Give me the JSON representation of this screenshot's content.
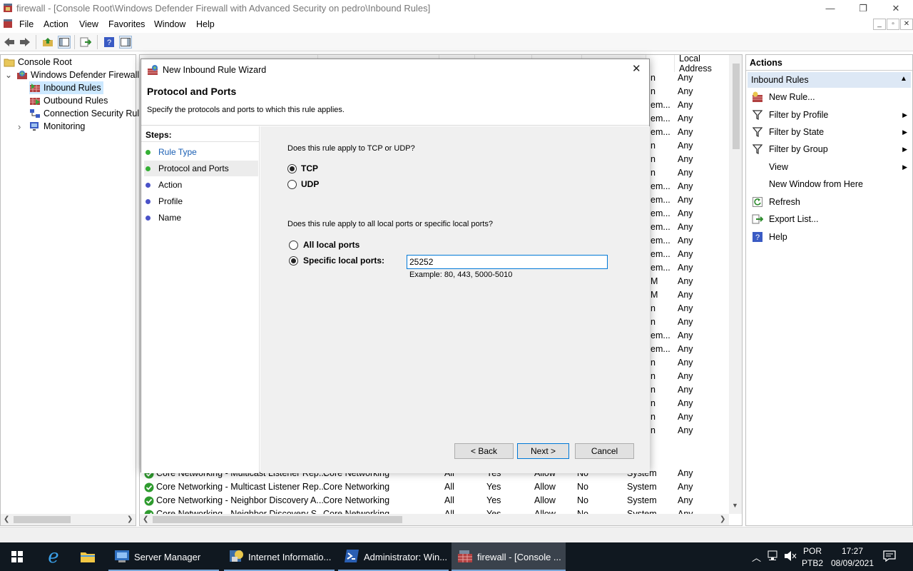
{
  "window": {
    "title": "firewall - [Console Root\\Windows Defender Firewall with Advanced Security on pedro\\Inbound Rules]",
    "minimize": "—",
    "restore": "❐",
    "close": "✕"
  },
  "menu": {
    "items": [
      "File",
      "Action",
      "View",
      "Favorites",
      "Window",
      "Help"
    ],
    "mdi": [
      "_",
      "▫",
      "✕"
    ]
  },
  "tree": {
    "items": [
      {
        "label": "Console Root"
      },
      {
        "label": "Windows Defender Firewall"
      },
      {
        "label": "Inbound Rules"
      },
      {
        "label": "Outbound Rules"
      },
      {
        "label": "Connection Security Rul"
      },
      {
        "label": "Monitoring"
      }
    ],
    "expander_open": "⌄",
    "expander_closed": "›"
  },
  "list": {
    "columns": {
      "local_address": "Local Address"
    },
    "right_fragments": [
      "n",
      "n",
      "em...",
      "em...",
      "em...",
      "n",
      "n",
      "n",
      "em...",
      "em...",
      "em...",
      "em...",
      "em...",
      "em...",
      "em...",
      "M",
      "M",
      "n",
      "n",
      "em...",
      "em...",
      "n",
      "n",
      "n",
      "n",
      "n",
      "n",
      "System",
      "System",
      "System",
      "System"
    ],
    "any_value": "Any",
    "rows": [
      {
        "name": "Core Networking - Multicast Listener Rep...",
        "group": "Core Networking",
        "profile": "All",
        "enabled": "Yes",
        "action": "Allow",
        "override": "No",
        "program": "System",
        "local": "Any"
      },
      {
        "name": "Core Networking - Multicast Listener Rep...",
        "group": "Core Networking",
        "profile": "All",
        "enabled": "Yes",
        "action": "Allow",
        "override": "No",
        "program": "System",
        "local": "Any"
      },
      {
        "name": "Core Networking - Neighbor Discovery A...",
        "group": "Core Networking",
        "profile": "All",
        "enabled": "Yes",
        "action": "Allow",
        "override": "No",
        "program": "System",
        "local": "Any"
      },
      {
        "name": "Core Networking - Neighbor Discovery S...",
        "group": "Core Networking",
        "profile": "All",
        "enabled": "Yes",
        "action": "Allow",
        "override": "No",
        "program": "System",
        "local": "Any"
      }
    ]
  },
  "actions": {
    "header": "Actions",
    "section": "Inbound Rules",
    "items": [
      {
        "label": "New Rule...",
        "icon": "new-rule-icon",
        "submenu": false
      },
      {
        "label": "Filter by Profile",
        "icon": "filter-icon",
        "submenu": true
      },
      {
        "label": "Filter by State",
        "icon": "filter-icon",
        "submenu": true
      },
      {
        "label": "Filter by Group",
        "icon": "filter-icon",
        "submenu": true
      },
      {
        "label": "View",
        "icon": "",
        "submenu": true
      },
      {
        "label": "New Window from Here",
        "icon": "",
        "submenu": false
      },
      {
        "label": "Refresh",
        "icon": "refresh-icon",
        "submenu": false
      },
      {
        "label": "Export List...",
        "icon": "export-icon",
        "submenu": false
      },
      {
        "label": "Help",
        "icon": "help-icon",
        "submenu": false
      }
    ]
  },
  "wizard": {
    "title": "New Inbound Rule Wizard",
    "heading": "Protocol and Ports",
    "subheading": "Specify the protocols and ports to which this rule applies.",
    "steps_header": "Steps:",
    "steps": [
      {
        "label": "Rule Type",
        "state": "done"
      },
      {
        "label": "Protocol and Ports",
        "state": "current"
      },
      {
        "label": "Action",
        "state": "pending"
      },
      {
        "label": "Profile",
        "state": "pending"
      },
      {
        "label": "Name",
        "state": "pending"
      }
    ],
    "q1": "Does this rule apply to TCP or UDP?",
    "tcp": "TCP",
    "udp": "UDP",
    "protocol_selected": "TCP",
    "q2": "Does this rule apply to all local ports or specific local ports?",
    "all_ports": "All local ports",
    "specific_ports": "Specific local ports:",
    "ports_selected": "specific",
    "ports_value": "25252",
    "example": "Example: 80, 443, 5000-5010",
    "back": "< Back",
    "next": "Next >",
    "cancel": "Cancel",
    "close": "✕"
  },
  "taskbar": {
    "tasks": [
      {
        "label": "Server Manager",
        "active": false
      },
      {
        "label": "Internet Informatio...",
        "active": false
      },
      {
        "label": "Administrator: Win...",
        "active": false
      },
      {
        "label": "firewall - [Console ...",
        "active": true
      }
    ],
    "lang1": "POR",
    "lang2": "PTB2",
    "time": "17:27",
    "date": "08/09/2021"
  },
  "colors": {
    "step_done": "#35b035",
    "step_pending": "#4a52c8",
    "link": "#1a5fb4",
    "selected_bg": "#cce8ff",
    "actions_header_bg": "#dde8f5"
  }
}
